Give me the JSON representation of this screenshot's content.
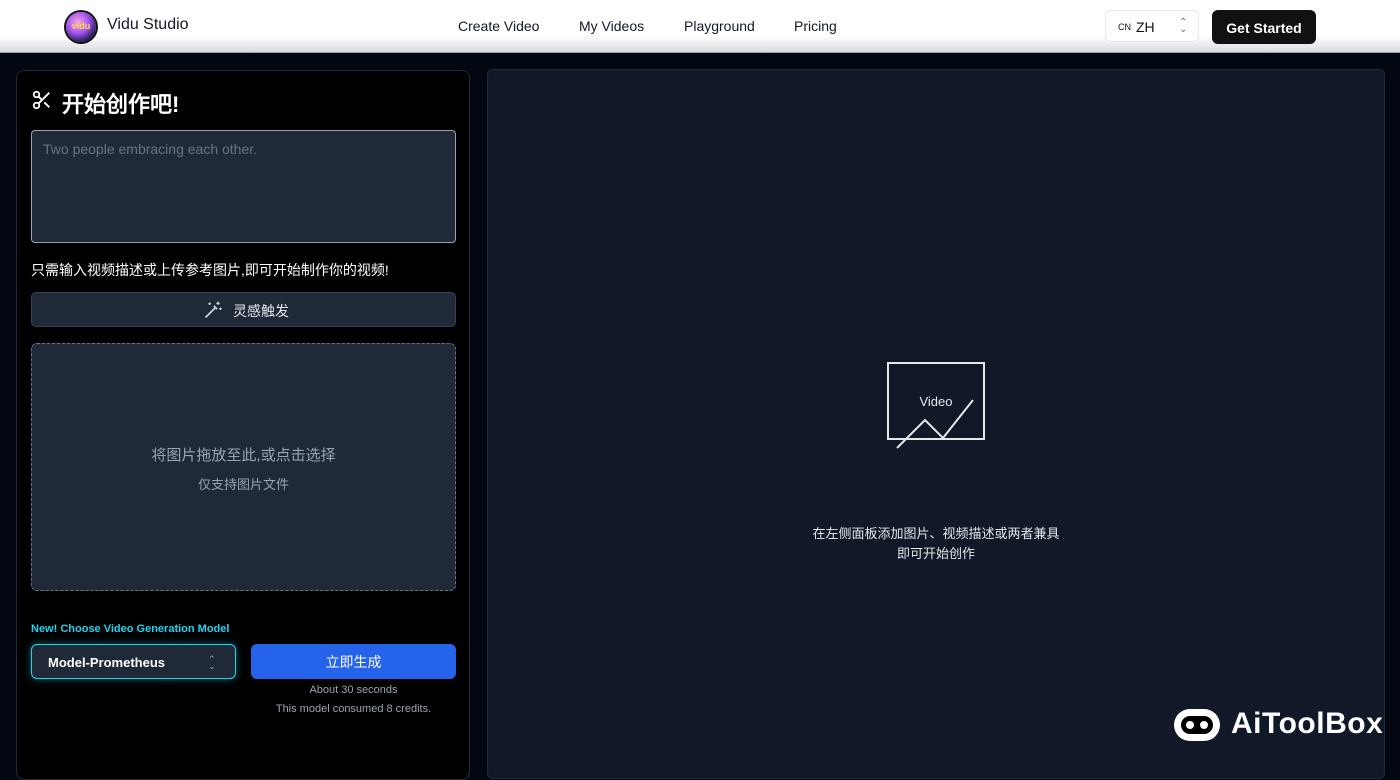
{
  "header": {
    "logo_text": "vidu",
    "brand": "Vidu Studio",
    "nav": [
      "Create Video",
      "My Videos",
      "Playground",
      "Pricing"
    ],
    "lang_flag": "CN",
    "lang": "ZH",
    "get_started": "Get Started"
  },
  "left": {
    "title": "开始创作吧!",
    "prompt_placeholder": "Two people embracing each other.",
    "hint": "只需输入视频描述或上传参考图片,即可开始制作你的视频!",
    "inspire": "灵感触发",
    "dropzone_main": "将图片拖放至此,或点击选择",
    "dropzone_sub": "仅支持图片文件",
    "model_label": "New! Choose Video Generation Model",
    "model_value": "Model-Prometheus",
    "generate": "立即生成",
    "time": "About 30 seconds",
    "credits": "This model consumed 8 credits."
  },
  "right": {
    "video_label": "Video",
    "empty_line1": "在左侧面板添加图片、视频描述或两者兼具",
    "empty_line2": "即可开始创作"
  },
  "watermark": "AiToolBox",
  "colors": {
    "accent_blue": "#2563eb",
    "accent_cyan": "#22d3ee",
    "panel_bg": "#111827",
    "input_bg": "#1f2937"
  }
}
